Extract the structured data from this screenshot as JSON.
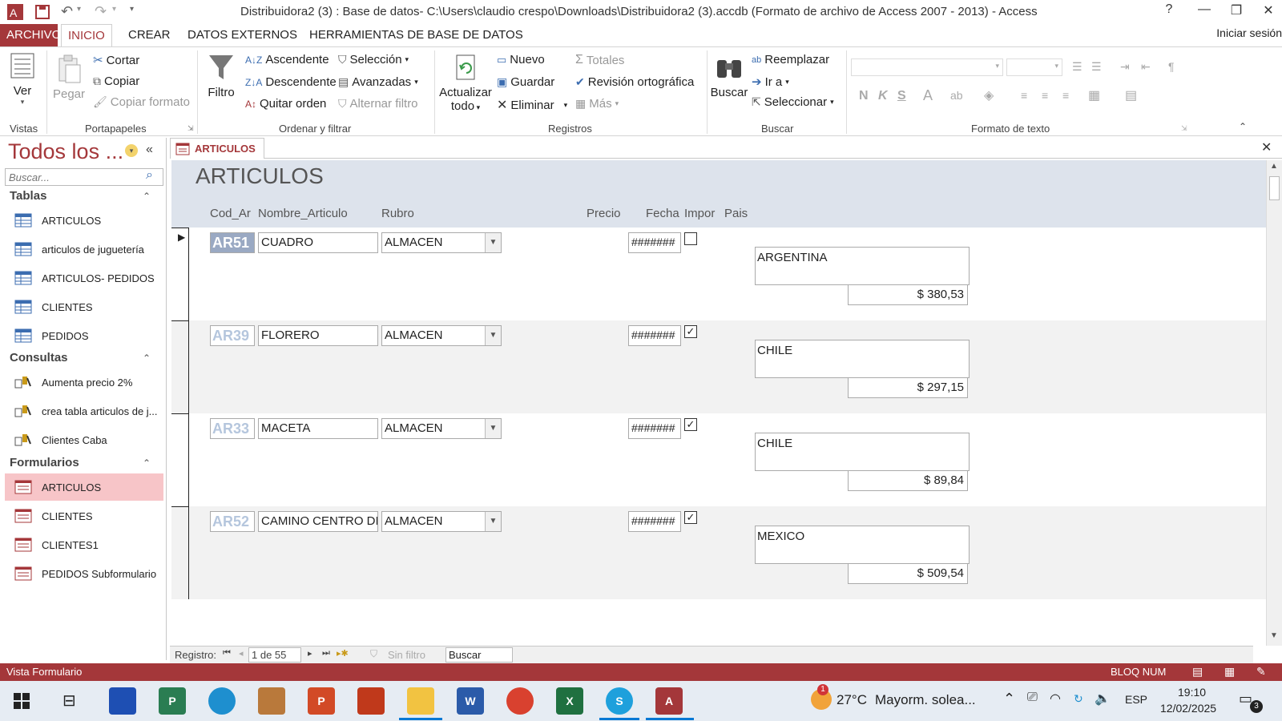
{
  "window": {
    "title": "Distribuidora2 (3) : Base de datos- C:\\Users\\claudio crespo\\Downloads\\Distribuidora2 (3).accdb (Formato de archivo de Access 2007 - 2013) - Access",
    "help": "?",
    "sign_in": "Iniciar sesión"
  },
  "tabs": [
    "ARCHIVO",
    "INICIO",
    "CREAR",
    "DATOS EXTERNOS",
    "HERRAMIENTAS DE BASE DE DATOS"
  ],
  "ribbon": {
    "vistas": {
      "ver": "Ver",
      "label": "Vistas"
    },
    "portapapeles": {
      "pegar": "Pegar",
      "cortar": "Cortar",
      "copiar": "Copiar",
      "copiar_formato": "Copiar formato",
      "label": "Portapapeles"
    },
    "ordenar": {
      "filtro": "Filtro",
      "ascendente": "Ascendente",
      "descendente": "Descendente",
      "quitar_orden": "Quitar orden",
      "seleccion": "Selección",
      "avanzadas": "Avanzadas",
      "alternar_filtro": "Alternar filtro",
      "label": "Ordenar y filtrar"
    },
    "registros": {
      "actualizar": "Actualizar",
      "todo": "todo",
      "nuevo": "Nuevo",
      "guardar": "Guardar",
      "eliminar": "Eliminar",
      "totales": "Totales",
      "revision": "Revisión ortográfica",
      "mas": "Más",
      "label": "Registros"
    },
    "buscar": {
      "buscar": "Buscar",
      "reemplazar": "Reemplazar",
      "ir_a": "Ir a",
      "seleccionar": "Seleccionar",
      "label": "Buscar"
    },
    "formato": {
      "bold": "N",
      "italic": "K",
      "underline": "S",
      "label": "Formato de texto"
    }
  },
  "nav": {
    "title": "Todos los ...",
    "search_placeholder": "Buscar...",
    "sections": [
      {
        "name": "Tablas",
        "items": [
          "ARTICULOS",
          "articulos de juguetería",
          "ARTICULOS- PEDIDOS",
          "CLIENTES",
          "PEDIDOS"
        ]
      },
      {
        "name": "Consultas",
        "items": [
          "Aumenta precio 2%",
          "crea tabla articulos de j...",
          "Clientes Caba"
        ]
      },
      {
        "name": "Formularios",
        "items": [
          "ARTICULOS",
          "CLIENTES",
          "CLIENTES1",
          "PEDIDOS Subformulario"
        ]
      }
    ],
    "selected": "ARTICULOS"
  },
  "document": {
    "tab": "ARTICULOS",
    "form_title": "ARTICULOS",
    "columns": [
      "Cod_Ar",
      "Nombre_Articulo",
      "Rubro",
      "Precio",
      "Fecha",
      "Impor",
      "Pais"
    ],
    "records": [
      {
        "code": "AR51",
        "name": "CUADRO",
        "rubro": "ALMACEN",
        "fecha": "#######",
        "importado": false,
        "pais": "ARGENTINA",
        "precio": "$ 380,53"
      },
      {
        "code": "AR39",
        "name": "FLORERO",
        "rubro": "ALMACEN",
        "fecha": "#######",
        "importado": true,
        "pais": "CHILE",
        "precio": "$ 297,15"
      },
      {
        "code": "AR33",
        "name": "MACETA",
        "rubro": "ALMACEN",
        "fecha": "#######",
        "importado": true,
        "pais": "CHILE",
        "precio": "$ 89,84"
      },
      {
        "code": "AR52",
        "name": "CAMINO CENTRO DI",
        "rubro": "ALMACEN",
        "fecha": "#######",
        "importado": true,
        "pais": "MEXICO",
        "precio": "$ 509,54"
      }
    ]
  },
  "record_nav": {
    "label": "Registro:",
    "position": "1 de 55",
    "filter": "Sin filtro",
    "search": "Buscar"
  },
  "status": {
    "left": "Vista Formulario",
    "right": "BLOQ NUM"
  },
  "taskbar": {
    "weather_temp": "27°C",
    "weather_text": "Mayorm. solea...",
    "lang": "ESP",
    "time": "19:10",
    "date": "12/02/2025",
    "notif_count": "3",
    "weather_badge": "1"
  },
  "colors": {
    "accent": "#a4373a",
    "selected_nav": "#f7c5c8",
    "form_header": "#dde3ec"
  }
}
